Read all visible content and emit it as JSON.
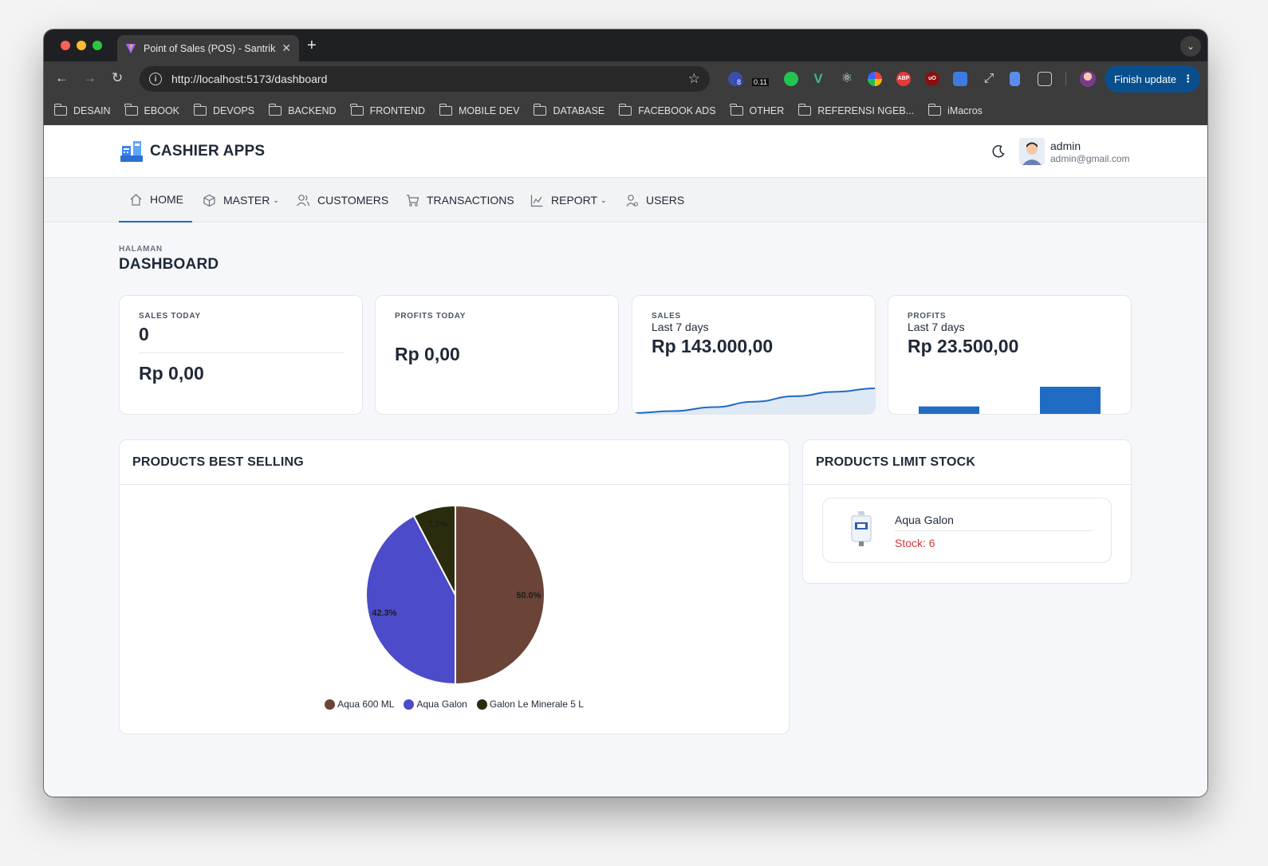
{
  "browser": {
    "tab_title": "Point of Sales (POS) - Santrik",
    "url": "http://localhost:5173/dashboard",
    "finish_update_label": "Finish update",
    "ext_badge_1": "8",
    "ext_badge_2": "0.11",
    "bookmarks": [
      "DESAIN",
      "EBOOK",
      "DEVOPS",
      "BACKEND",
      "FRONTEND",
      "MOBILE DEV",
      "DATABASE",
      "FACEBOOK ADS",
      "OTHER",
      "REFERENSI NGEB...",
      "iMacros"
    ]
  },
  "header": {
    "app_title": "CASHIER APPS",
    "user_name": "admin",
    "user_email": "admin@gmail.com"
  },
  "nav": {
    "home": "HOME",
    "master": "MASTER",
    "customers": "CUSTOMERS",
    "transactions": "TRANSACTIONS",
    "report": "REPORT",
    "users": "USERS"
  },
  "page": {
    "pretitle": "HALAMAN",
    "title": "DASHBOARD"
  },
  "stats": {
    "sales_today": {
      "label": "SALES TODAY",
      "count": "0",
      "amount": "Rp 0,00"
    },
    "profits_today": {
      "label": "PROFITS TODAY",
      "amount": "Rp 0,00"
    },
    "sales_week": {
      "label": "SALES",
      "period": "Last 7 days",
      "amount": "Rp 143.000,00"
    },
    "profits_week": {
      "label": "PROFITS",
      "period": "Last 7 days",
      "amount": "Rp 23.500,00"
    }
  },
  "best_selling": {
    "title": "PRODUCTS BEST SELLING"
  },
  "limit_stock": {
    "title": "PRODUCTS LIMIT STOCK",
    "items": [
      {
        "name": "Aqua Galon",
        "stock": "Stock: 6"
      }
    ]
  },
  "colors": {
    "primary": "#206bc4",
    "danger": "#d63939",
    "pie": [
      "#6b4437",
      "#4c4bc9",
      "#2b2b0d"
    ]
  },
  "chart_data": [
    {
      "type": "pie",
      "title": "",
      "categories": [
        "Aqua 600 ML",
        "Aqua Galon",
        "Galon Le Minerale 5 L"
      ],
      "values": [
        50.0,
        42.3,
        7.7
      ],
      "labels": [
        "50.0%",
        "42.3%",
        "7.7%"
      ],
      "legend": "bottom-center"
    },
    {
      "type": "area",
      "title": "",
      "x": [
        1,
        2,
        3,
        4,
        5,
        6,
        7
      ],
      "values": [
        0,
        8,
        24,
        46,
        68,
        86,
        100
      ],
      "grid": false
    },
    {
      "type": "bar",
      "title": "",
      "categories": [
        "1",
        "2"
      ],
      "values": [
        11,
        35
      ],
      "grid": false
    }
  ]
}
